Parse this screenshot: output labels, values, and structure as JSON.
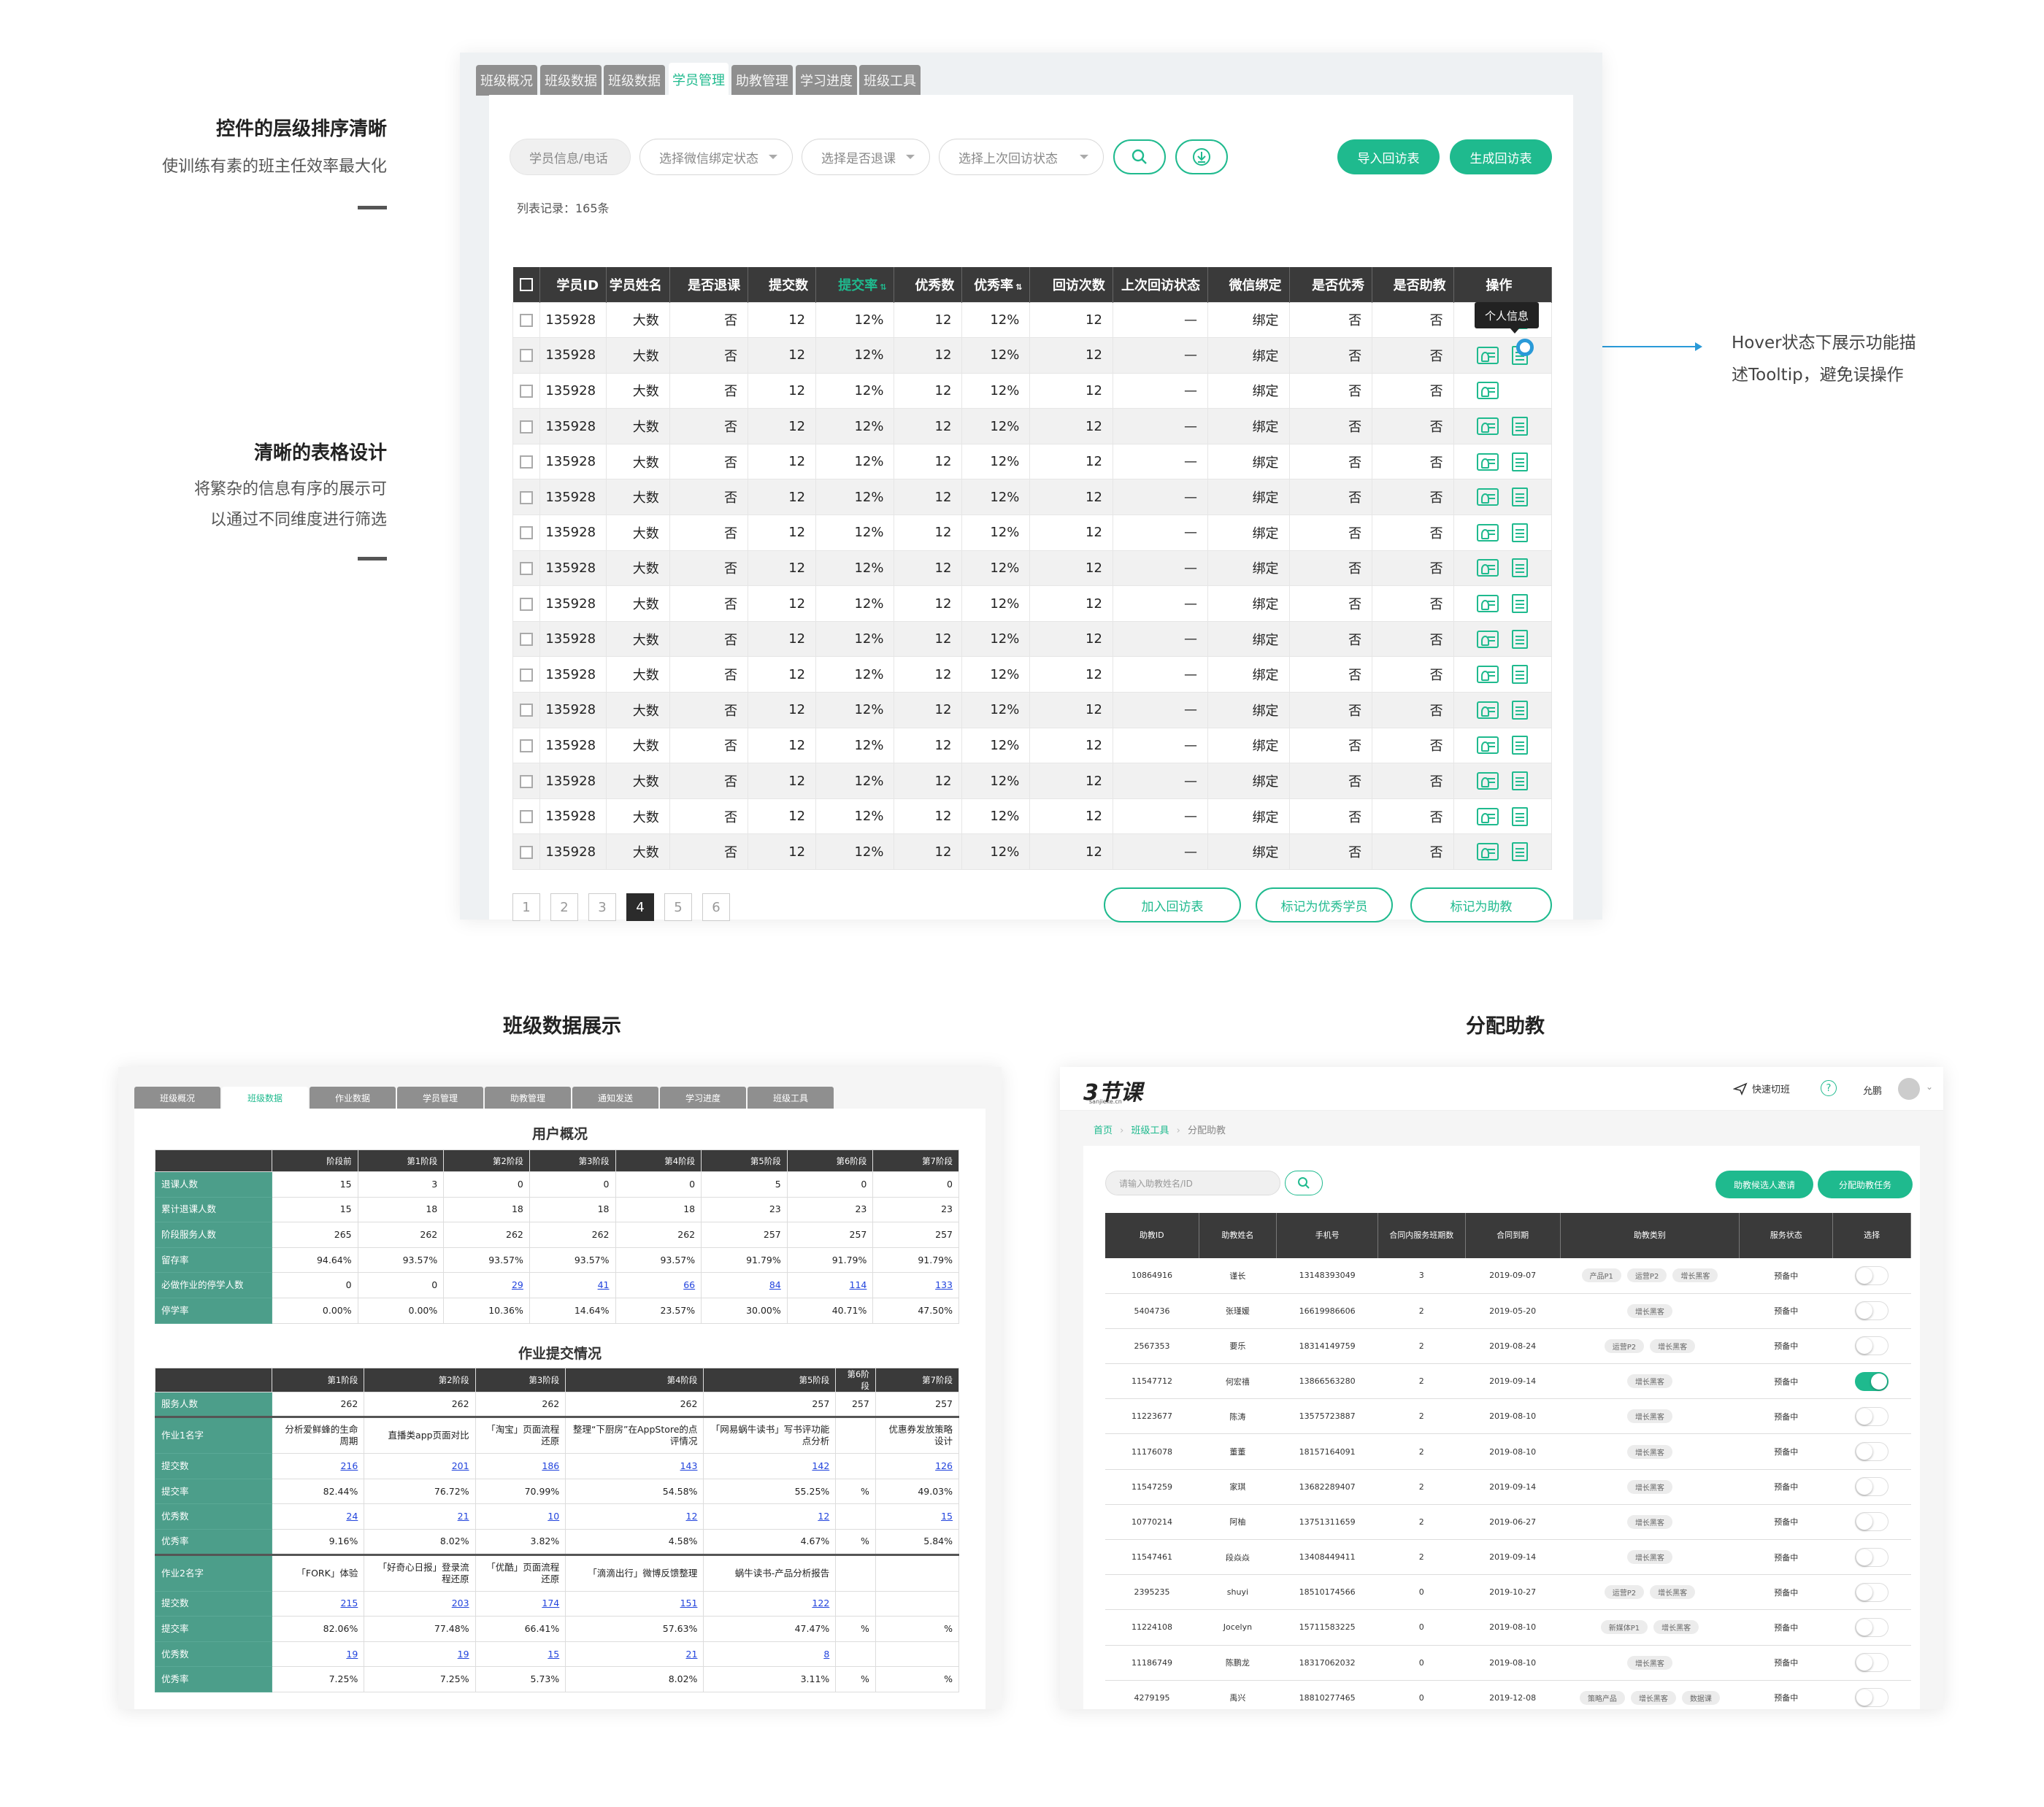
{
  "annotations": {
    "a1_title": "控件的层级排序清晰",
    "a1_text": "使训练有素的班主任效率最大化",
    "a2_title": "清晰的表格设计",
    "a2_line1": "将繁杂的信息有序的展示可",
    "a2_line2": "以通过不同维度进行筛选",
    "hover_line1": "Hover状态下展示功能描",
    "hover_line2": "述Tooltip，避免误操作"
  },
  "main": {
    "tabs": [
      "班级概况",
      "班级数据",
      "班级数据",
      "学员管理",
      "助教管理",
      "学习进度",
      "班级工具"
    ],
    "active_tab": 3,
    "filters": {
      "search_placeholder": "学员信息/电话",
      "wechat": "选择微信绑定状态",
      "dropout": "选择是否退课",
      "last_visit": "选择上次回访状态"
    },
    "actions": {
      "import": "导入回访表",
      "generate": "生成回访表"
    },
    "record_count": "列表记录：165条",
    "columns": [
      "学员ID",
      "学员姓名",
      "是否退课",
      "提交数",
      "提交率",
      "优秀数",
      "优秀率",
      "回访次数",
      "上次回访状态",
      "微信绑定",
      "是否优秀",
      "是否助教",
      "操作"
    ],
    "sorted_column": "提交率",
    "row": {
      "id": "135928",
      "name": "大数",
      "dropout": "否",
      "submits": "12",
      "submit_rate": "12%",
      "excellent": "12",
      "excellent_rate": "12%",
      "visits": "12",
      "last_visit": "—",
      "wechat": "绑定",
      "is_excellent": "否",
      "is_ta": "否"
    },
    "row_count": 16,
    "tooltip": "个人信息",
    "pages": [
      "1",
      "2",
      "3",
      "4",
      "5",
      "6"
    ],
    "current_page": "4",
    "bulk": {
      "add": "加入回访表",
      "mark_excellent": "标记为优秀学员",
      "mark_ta": "标记为助教"
    }
  },
  "sections": {
    "left": "班级数据展示",
    "right": "分配助教"
  },
  "class_data": {
    "tabs": [
      "班级概况",
      "班级数据",
      "作业数据",
      "学员管理",
      "助教管理",
      "通知发送",
      "学习进度",
      "班级工具"
    ],
    "active_tab": 1,
    "overview_title": "用户概况",
    "overview_cols": [
      "阶段前",
      "第1阶段",
      "第2阶段",
      "第3阶段",
      "第4阶段",
      "第5阶段",
      "第6阶段",
      "第7阶段"
    ],
    "overview_rows": [
      {
        "label": "退课人数",
        "values": [
          "15",
          "3",
          "0",
          "0",
          "0",
          "5",
          "0",
          "0"
        ]
      },
      {
        "label": "累计退课人数",
        "values": [
          "15",
          "18",
          "18",
          "18",
          "18",
          "23",
          "23",
          "23"
        ]
      },
      {
        "label": "阶段服务人数",
        "values": [
          "265",
          "262",
          "262",
          "262",
          "262",
          "257",
          "257",
          "257"
        ]
      },
      {
        "label": "留存率",
        "values": [
          "94.64%",
          "93.57%",
          "93.57%",
          "93.57%",
          "93.57%",
          "91.79%",
          "91.79%",
          "91.79%"
        ]
      },
      {
        "label": "必做作业的停学人数",
        "values": [
          "0",
          "0",
          "29",
          "41",
          "66",
          "84",
          "114",
          "133"
        ]
      },
      {
        "label": "停学率",
        "values": [
          "0.00%",
          "0.00%",
          "10.36%",
          "14.64%",
          "23.57%",
          "30.00%",
          "40.71%",
          "47.50%"
        ]
      }
    ],
    "homework_title": "作业提交情况",
    "homework_cols": [
      "第1阶段",
      "第2阶段",
      "第3阶段",
      "第4阶段",
      "第5阶段",
      "第6阶段",
      "第7阶段"
    ],
    "service_row": {
      "label": "服务人数",
      "values": [
        "262",
        "262",
        "262",
        "262",
        "257",
        "257",
        "257"
      ]
    },
    "hw1": {
      "label": "作业1名字",
      "names": [
        "分析爱鲜蜂的生命周期",
        "直播类app页面对比",
        "「淘宝」页面流程还原",
        "整理“下厨房”在AppStore的点评情况",
        "「网易蜗牛读书」写书评功能点分析",
        "",
        "优惠券发放策略设计"
      ],
      "rows": [
        {
          "label": "提交数",
          "values": [
            "216",
            "201",
            "186",
            "143",
            "142",
            "",
            "126"
          ]
        },
        {
          "label": "提交率",
          "values": [
            "82.44%",
            "76.72%",
            "70.99%",
            "54.58%",
            "55.25%",
            "%",
            "49.03%"
          ]
        },
        {
          "label": "优秀数",
          "values": [
            "24",
            "21",
            "10",
            "12",
            "12",
            "",
            "15"
          ]
        },
        {
          "label": "优秀率",
          "values": [
            "9.16%",
            "8.02%",
            "3.82%",
            "4.58%",
            "4.67%",
            "%",
            "5.84%"
          ]
        }
      ]
    },
    "hw2": {
      "label": "作业2名字",
      "names": [
        "「FORK」体验",
        "「好奇心日报」登录流程还原",
        "「优酷」页面流程还原",
        "「滴滴出行」微博反馈整理",
        "蜗牛读书-产品分析报告",
        "",
        ""
      ],
      "rows": [
        {
          "label": "提交数",
          "values": [
            "215",
            "203",
            "174",
            "151",
            "122",
            "",
            ""
          ]
        },
        {
          "label": "提交率",
          "values": [
            "82.06%",
            "77.48%",
            "66.41%",
            "57.63%",
            "47.47%",
            "%",
            "%"
          ]
        },
        {
          "label": "优秀数",
          "values": [
            "19",
            "19",
            "15",
            "21",
            "8",
            "",
            ""
          ]
        },
        {
          "label": "优秀率",
          "values": [
            "7.25%",
            "7.25%",
            "5.73%",
            "8.02%",
            "3.11%",
            "%",
            "%"
          ]
        }
      ]
    }
  },
  "assign": {
    "logo": "3节课",
    "logo_sub": "sanjieke.cn",
    "quick_switch": "快速切班",
    "help": "?",
    "user": "允鹏",
    "breadcrumb": [
      "首页",
      "班级工具",
      "分配助教"
    ],
    "search_placeholder": "请输入助教姓名/ID",
    "btn_invite": "助教候选人邀请",
    "btn_assign": "分配助教任务",
    "columns": [
      "助教ID",
      "助教姓名",
      "手机号",
      "合同内服务班期数",
      "合同到期",
      "助教类别",
      "服务状态",
      "选择"
    ],
    "rows": [
      {
        "id": "10864916",
        "name": "谨长",
        "phone": "13148393049",
        "count": "3",
        "expire": "2019-09-07",
        "tags": [
          "产品P1",
          "运营P2",
          "增长黑客"
        ],
        "status": "预备中",
        "on": false
      },
      {
        "id": "5404736",
        "name": "张瑾媛",
        "phone": "16619986606",
        "count": "2",
        "expire": "2019-05-20",
        "tags": [
          "增长黑客"
        ],
        "status": "预备中",
        "on": false
      },
      {
        "id": "2567353",
        "name": "要乐",
        "phone": "18314149759",
        "count": "2",
        "expire": "2019-08-24",
        "tags": [
          "运营P2",
          "增长黑客"
        ],
        "status": "预备中",
        "on": false
      },
      {
        "id": "11547712",
        "name": "何宏禧",
        "phone": "13866563280",
        "count": "2",
        "expire": "2019-09-14",
        "tags": [
          "增长黑客"
        ],
        "status": "预备中",
        "on": true
      },
      {
        "id": "11223677",
        "name": "陈涛",
        "phone": "13575723887",
        "count": "2",
        "expire": "2019-08-10",
        "tags": [
          "增长黑客"
        ],
        "status": "预备中",
        "on": false
      },
      {
        "id": "11176078",
        "name": "董董",
        "phone": "18157164091",
        "count": "2",
        "expire": "2019-08-10",
        "tags": [
          "增长黑客"
        ],
        "status": "预备中",
        "on": false
      },
      {
        "id": "11547259",
        "name": "家琪",
        "phone": "13682289407",
        "count": "2",
        "expire": "2019-09-14",
        "tags": [
          "增长黑客"
        ],
        "status": "预备中",
        "on": false
      },
      {
        "id": "10770214",
        "name": "阿柚",
        "phone": "13751311659",
        "count": "2",
        "expire": "2019-06-27",
        "tags": [
          "增长黑客"
        ],
        "status": "预备中",
        "on": false
      },
      {
        "id": "11547461",
        "name": "段焱焱",
        "phone": "13408449411",
        "count": "2",
        "expire": "2019-09-14",
        "tags": [
          "增长黑客"
        ],
        "status": "预备中",
        "on": false
      },
      {
        "id": "2395235",
        "name": "shuyi",
        "phone": "18510174566",
        "count": "0",
        "expire": "2019-10-27",
        "tags": [
          "运营P2",
          "增长黑客"
        ],
        "status": "预备中",
        "on": false
      },
      {
        "id": "11224108",
        "name": "Jocelyn",
        "phone": "15711583225",
        "count": "0",
        "expire": "2019-08-10",
        "tags": [
          "新媒体P1",
          "增长黑客"
        ],
        "status": "预备中",
        "on": false
      },
      {
        "id": "11186749",
        "name": "陈鹏龙",
        "phone": "18317062032",
        "count": "0",
        "expire": "2019-08-10",
        "tags": [
          "增长黑客"
        ],
        "status": "预备中",
        "on": false
      },
      {
        "id": "4279195",
        "name": "禹兴",
        "phone": "18810277465",
        "count": "0",
        "expire": "2019-12-08",
        "tags": [
          "策略产品",
          "增长黑客",
          "数据课"
        ],
        "status": "预备中",
        "on": false
      }
    ]
  }
}
